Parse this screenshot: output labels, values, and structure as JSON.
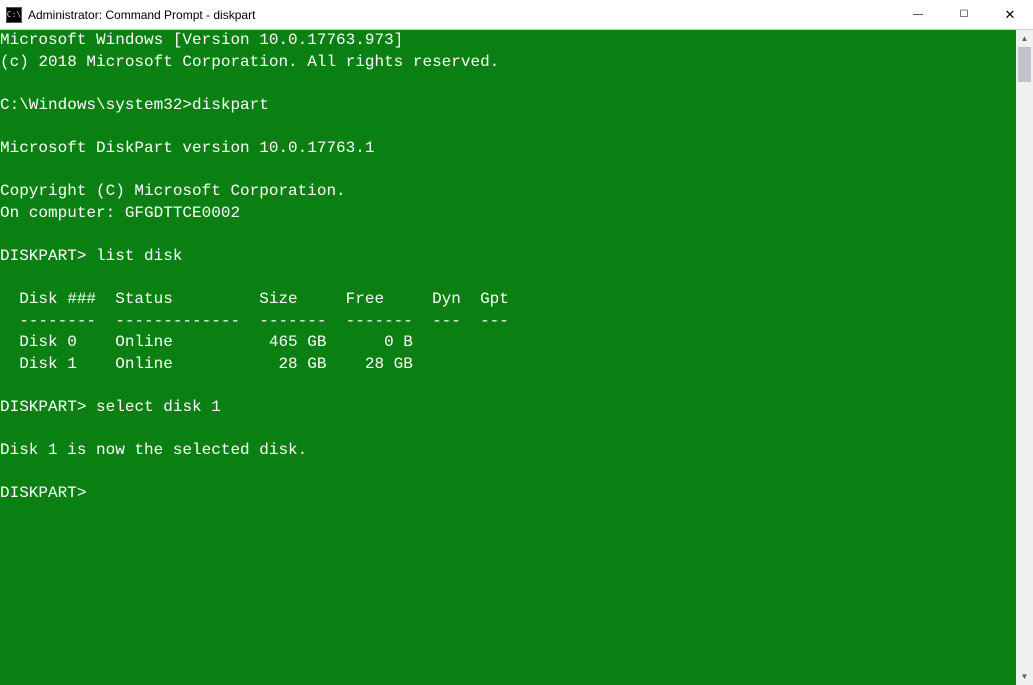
{
  "titlebar": {
    "icon_label": "C:\\",
    "title": "Administrator: Command Prompt - diskpart"
  },
  "win_controls": {
    "minimize": "—",
    "maximize": "☐",
    "close": "✕"
  },
  "terminal": {
    "header_line1": "Microsoft Windows [Version 10.0.17763.973]",
    "header_line2": "(c) 2018 Microsoft Corporation. All rights reserved.",
    "prompt1_path": "C:\\Windows\\system32>",
    "prompt1_cmd": "diskpart",
    "dp_version": "Microsoft DiskPart version 10.0.17763.1",
    "dp_copyright": "Copyright (C) Microsoft Corporation.",
    "dp_computer": "On computer: GFGDTTCE0002",
    "prompt2_label": "DISKPART>",
    "prompt2_cmd": "list disk",
    "disk_header": "  Disk ###  Status         Size     Free     Dyn  Gpt",
    "disk_separator": "  --------  -------------  -------  -------  ---  ---",
    "disk_row0": "  Disk 0    Online          465 GB      0 B        ",
    "disk_row1": "  Disk 1    Online           28 GB    28 GB        ",
    "prompt3_label": "DISKPART>",
    "prompt3_cmd": "select disk 1",
    "select_result": "Disk 1 is now the selected disk.",
    "prompt4_label": "DISKPART>"
  },
  "scroll": {
    "up": "▲",
    "down": "▼"
  },
  "colors": {
    "terminal_bg": "#0a7f12",
    "terminal_fg": "#ffffff"
  }
}
